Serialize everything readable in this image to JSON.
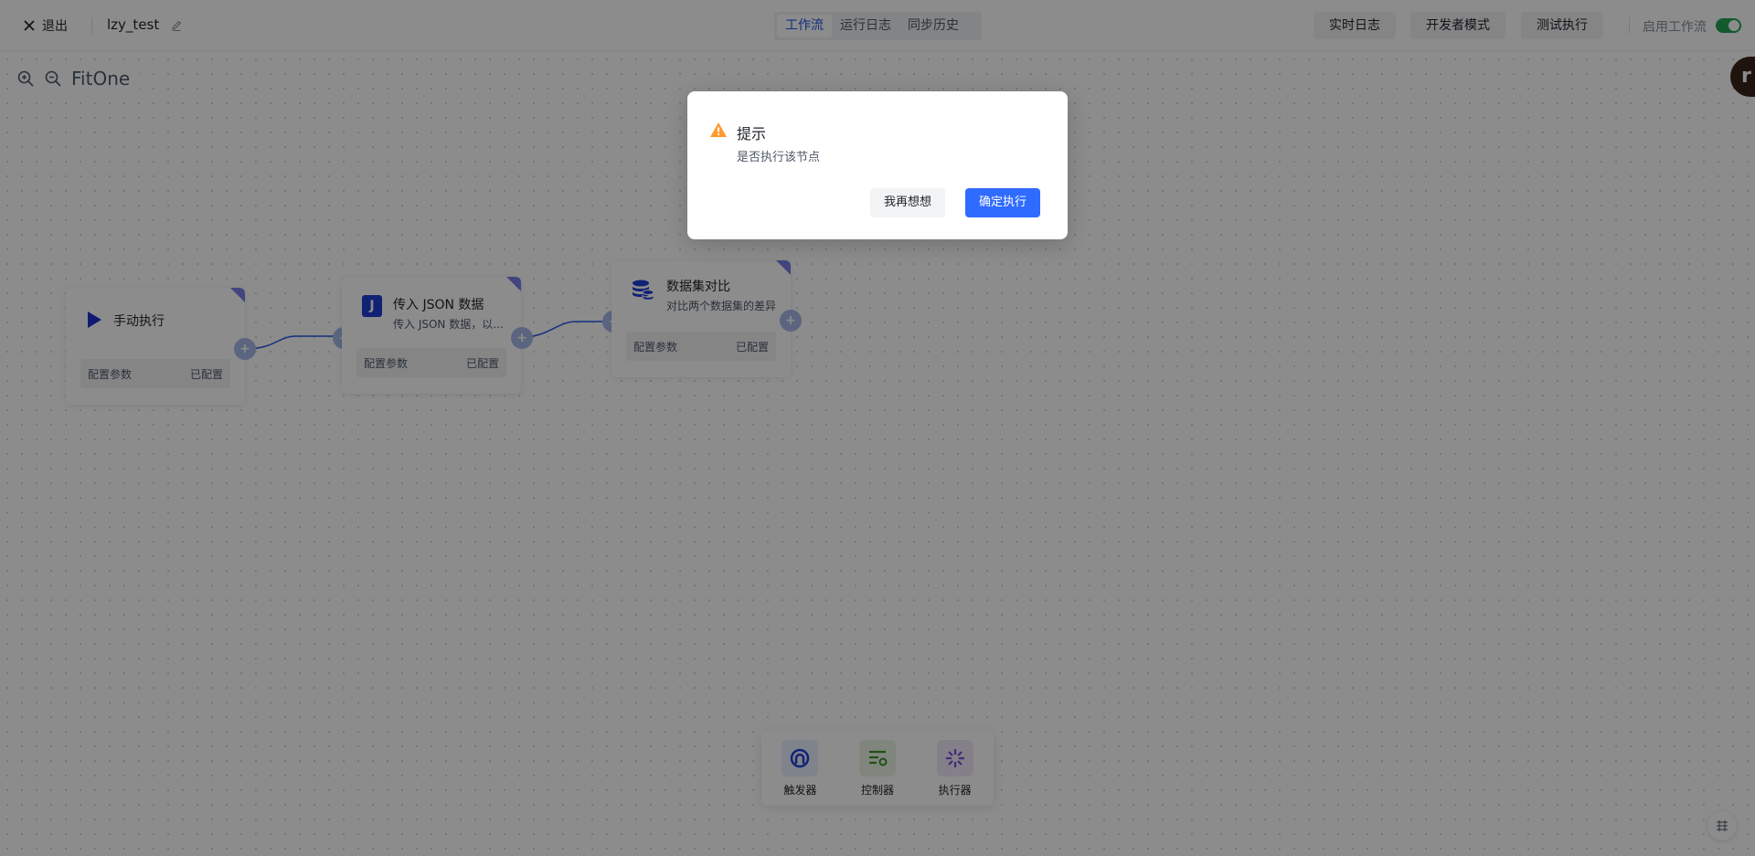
{
  "header": {
    "exit_label": "退出",
    "workflow_name": "lzy_test",
    "tabs": [
      {
        "label": "工作流",
        "active": true
      },
      {
        "label": "运行日志",
        "active": false
      },
      {
        "label": "同步历史",
        "active": false
      }
    ],
    "realtime_log": "实时日志",
    "developer_mode": "开发者模式",
    "test_run": "测试执行",
    "enable_workflow_label": "启用工作流",
    "enable_workflow_on": true
  },
  "zoom": {
    "zoom_in_icon": "zoom-in-icon",
    "zoom_out_icon": "zoom-out-icon",
    "fit_label": "FitOne"
  },
  "nodes": [
    {
      "title": "手动执行",
      "desc": "",
      "icon": "play-icon",
      "config_label": "配置参数",
      "config_status": "已配置"
    },
    {
      "title": "传入 JSON 数据",
      "desc": "传入 JSON 数据，以...",
      "icon": "json-icon",
      "config_label": "配置参数",
      "config_status": "已配置"
    },
    {
      "title": "数据集对比",
      "desc": "对比两个数据集的差异",
      "icon": "database-icon",
      "config_label": "配置参数",
      "config_status": "已配置"
    }
  ],
  "palette": [
    {
      "label": "触发器",
      "icon": "trigger-icon"
    },
    {
      "label": "控制器",
      "icon": "controller-icon"
    },
    {
      "label": "执行器",
      "icon": "executor-icon"
    }
  ],
  "avatar": {
    "letter": "r"
  },
  "dialog": {
    "title": "提示",
    "message": "是否执行该节点",
    "cancel_label": "我再想想",
    "confirm_label": "确定执行"
  },
  "colors": {
    "primary": "#2f6bff",
    "toggle_on": "#23a455",
    "node_corner": "#7b7fe8",
    "warning": "#ff9a2e"
  }
}
